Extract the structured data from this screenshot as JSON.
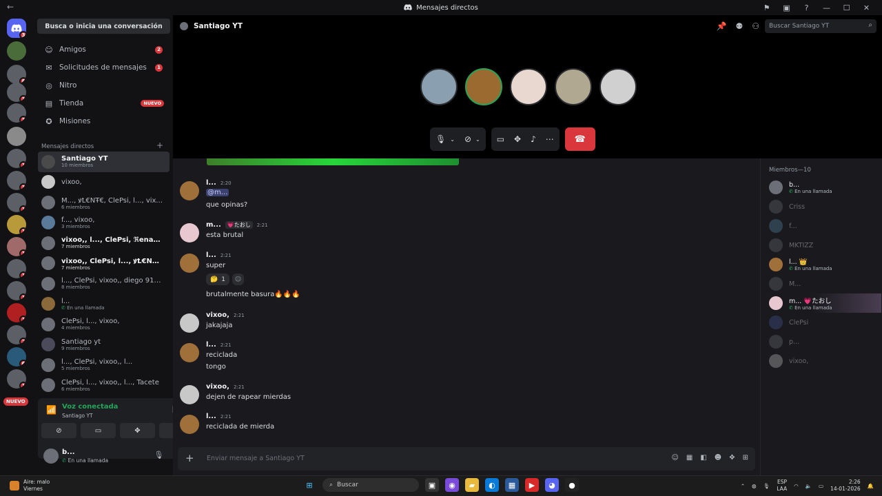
{
  "window": {
    "title": "Mensajes directos",
    "back": "←"
  },
  "servers": {
    "new_pill": "NUEVO",
    "badges": [
      "3",
      "",
      "8",
      "3",
      "3",
      "1",
      "",
      "1",
      "3",
      "1",
      "1",
      "1",
      "1",
      "1",
      "1",
      "2",
      "1",
      "1",
      "6",
      "1"
    ]
  },
  "dm_sidebar": {
    "search_label": "Busca o inicia una conversación",
    "nav": [
      {
        "label": "Amigos",
        "icon": "friends-icon",
        "count": "2"
      },
      {
        "label": "Solicitudes de mensajes",
        "icon": "mail-icon",
        "count": "1"
      },
      {
        "label": "Nitro",
        "icon": "nitro-icon"
      },
      {
        "label": "Tienda",
        "icon": "shop-icon",
        "new": "NUEVO"
      },
      {
        "label": "Misiones",
        "icon": "quests-icon"
      }
    ],
    "dm_header": "Mensajes directos",
    "dm_add": "+",
    "dms": [
      {
        "name": "Santiago YT",
        "sub": "10 miembros"
      },
      {
        "name": "vixoo,",
        "sub": ""
      },
      {
        "name": "M..., ꝟꝈ€ΝŦ€, ClePsi, l..., vixoo,",
        "sub": "6 miembros"
      },
      {
        "name": "f..., vixoo,",
        "sub": "3 miembros"
      },
      {
        "name": "vixoo,, l..., ClePsi, ℜenato, MK...",
        "sub": "7 miembros"
      },
      {
        "name": "vixoo,, ClePsi, l..., ꝟꝈ€ΝŦ€, p...",
        "sub": "7 miembros"
      },
      {
        "name": "l..., ClePsi, vixoo,, diego 91o10, ...",
        "sub": "8 miembros"
      },
      {
        "name": "l...",
        "sub": "En una llamada"
      },
      {
        "name": "ClePsi, l..., vixoo,",
        "sub": "4 miembros"
      },
      {
        "name": "Santiago yt",
        "sub": "9 miembros"
      },
      {
        "name": "l..., ClePsi, vixoo,, l...",
        "sub": "5 miembros"
      },
      {
        "name": "ClePsi, l..., vixoo,, l..., Tacete",
        "sub": "6 miembros"
      }
    ]
  },
  "voice": {
    "status": "Voz conectada",
    "channel": "Santiago YT"
  },
  "user": {
    "name": "b...",
    "status": "En una llamada"
  },
  "call": {
    "title": "Santiago YT",
    "search_placeholder": "Buscar Santiago YT"
  },
  "messages": [
    {
      "author": "l...",
      "time": "2:20",
      "lines": [
        "@m...",
        "que opinas?"
      ]
    },
    {
      "author": "m...",
      "tag": "💗たおし",
      "time": "2:21",
      "lines": [
        "esta brutal"
      ]
    },
    {
      "author": "l...",
      "time": "2:21",
      "lines": [
        "super",
        "brutalmente basura🔥🔥🔥"
      ],
      "reaction": {
        "emoji": "🤔",
        "count": "1"
      }
    },
    {
      "author": "vixoo,",
      "time": "2:21",
      "lines": [
        "jakajaja"
      ]
    },
    {
      "author": "l...",
      "time": "2:21",
      "lines": [
        "reciclada",
        "tongo"
      ]
    },
    {
      "author": "vixoo,",
      "time": "2:21",
      "lines": [
        "dejen de rapear mierdas"
      ]
    },
    {
      "author": "l...",
      "time": "2:21",
      "lines": [
        "reciclada de mierda"
      ]
    }
  ],
  "composer": {
    "placeholder": "Enviar mensaje a Santiago YT"
  },
  "members_panel": {
    "header": "Miembros—10",
    "members": [
      {
        "name": "b...",
        "status": "En una llamada",
        "active": true
      },
      {
        "name": "Criss",
        "status": "",
        "active": false
      },
      {
        "name": "f...",
        "status": "",
        "active": false
      },
      {
        "name": "MKTIZZ",
        "status": "",
        "active": false
      },
      {
        "name": "l... 👑",
        "status": "En una llamada",
        "active": true
      },
      {
        "name": "M...",
        "status": "",
        "active": false
      },
      {
        "name": "m... 💗たおし",
        "status": "En una llamada",
        "active": true
      },
      {
        "name": "ClePsi",
        "status": "",
        "active": false
      },
      {
        "name": "p...",
        "status": "",
        "active": false
      },
      {
        "name": "vixoo,",
        "status": "",
        "active": false
      }
    ]
  },
  "taskbar": {
    "weather_title": "Aire: malo",
    "weather_sub": "Viernes",
    "search": "Buscar",
    "lang": "ESP",
    "lang2": "LAA",
    "time": "2:26",
    "date": "14-01-2026"
  },
  "colors": {
    "accent": "#5865f2",
    "danger": "#da373c",
    "online": "#23a55a"
  }
}
